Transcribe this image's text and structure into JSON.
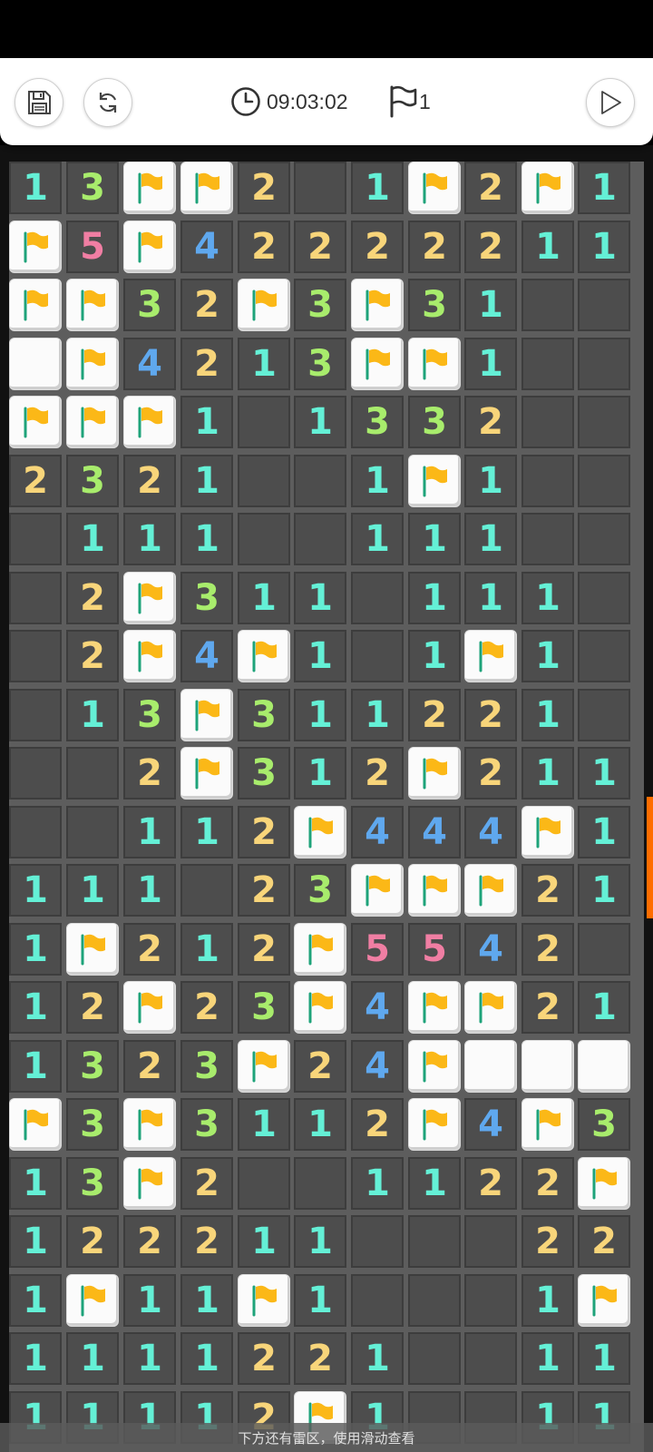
{
  "toolbar": {
    "timer": "09:03:02",
    "flag_count": "1"
  },
  "board": {
    "rows": [
      [
        "1",
        "3",
        "F",
        "F",
        "2",
        "",
        "1",
        "F",
        "2",
        "F",
        "1"
      ],
      [
        "F",
        "5",
        "F",
        "4",
        "2",
        "2",
        "2",
        "2",
        "2",
        "1",
        "1"
      ],
      [
        "F",
        "F",
        "3",
        "2",
        "F",
        "3",
        "F",
        "3",
        "1",
        "",
        ""
      ],
      [
        "C",
        "F",
        "4",
        "2",
        "1",
        "3",
        "F",
        "F",
        "1",
        "",
        ""
      ],
      [
        "F",
        "F",
        "F",
        "1",
        "",
        "1",
        "3",
        "3",
        "2",
        "",
        ""
      ],
      [
        "2",
        "3",
        "2",
        "1",
        "",
        "",
        "1",
        "F",
        "1",
        "",
        ""
      ],
      [
        "",
        "1",
        "1",
        "1",
        "",
        "",
        "1",
        "1",
        "1",
        "",
        ""
      ],
      [
        "",
        "2",
        "F",
        "3",
        "1",
        "1",
        "",
        "1",
        "1",
        "1",
        ""
      ],
      [
        "",
        "2",
        "F",
        "4",
        "F",
        "1",
        "",
        "1",
        "F",
        "1",
        ""
      ],
      [
        "",
        "1",
        "3",
        "F",
        "3",
        "1",
        "1",
        "2",
        "2",
        "1",
        ""
      ],
      [
        "",
        "",
        "2",
        "F",
        "3",
        "1",
        "2",
        "F",
        "2",
        "1",
        "1"
      ],
      [
        "",
        "",
        "1",
        "1",
        "2",
        "F",
        "4",
        "4",
        "4",
        "F",
        "1"
      ],
      [
        "1",
        "1",
        "1",
        "",
        "2",
        "3",
        "F",
        "F",
        "F",
        "2",
        "1"
      ],
      [
        "1",
        "F",
        "2",
        "1",
        "2",
        "F",
        "5",
        "5",
        "4",
        "2",
        ""
      ],
      [
        "1",
        "2",
        "F",
        "2",
        "3",
        "F",
        "4",
        "F",
        "F",
        "2",
        "1"
      ],
      [
        "1",
        "3",
        "2",
        "3",
        "F",
        "2",
        "4",
        "F",
        "C",
        "C",
        "C"
      ],
      [
        "F",
        "3",
        "F",
        "3",
        "1",
        "1",
        "2",
        "F",
        "4",
        "F",
        "3"
      ],
      [
        "1",
        "3",
        "F",
        "2",
        "",
        "",
        "1",
        "1",
        "2",
        "2",
        "F"
      ],
      [
        "1",
        "2",
        "2",
        "2",
        "1",
        "1",
        "",
        "",
        "",
        "2",
        "2"
      ],
      [
        "1",
        "F",
        "1",
        "1",
        "F",
        "1",
        "",
        "",
        "",
        "1",
        "F"
      ],
      [
        "1",
        "1",
        "1",
        "1",
        "2",
        "2",
        "1",
        "",
        "",
        "1",
        "1"
      ],
      [
        "1",
        "1",
        "1",
        "1",
        "2",
        "F",
        "1",
        "",
        "",
        "1",
        "1"
      ]
    ]
  },
  "number_colors": {
    "1": "#64f0d6",
    "2": "#f8d57a",
    "3": "#a8ec6c",
    "4": "#5fa8ee",
    "5": "#f07ea3"
  },
  "flag_colors": {
    "flag": "#fbb817",
    "pole": "#1ea37a"
  },
  "bottom_hint": "下方还有雷区，使用滑动查看"
}
